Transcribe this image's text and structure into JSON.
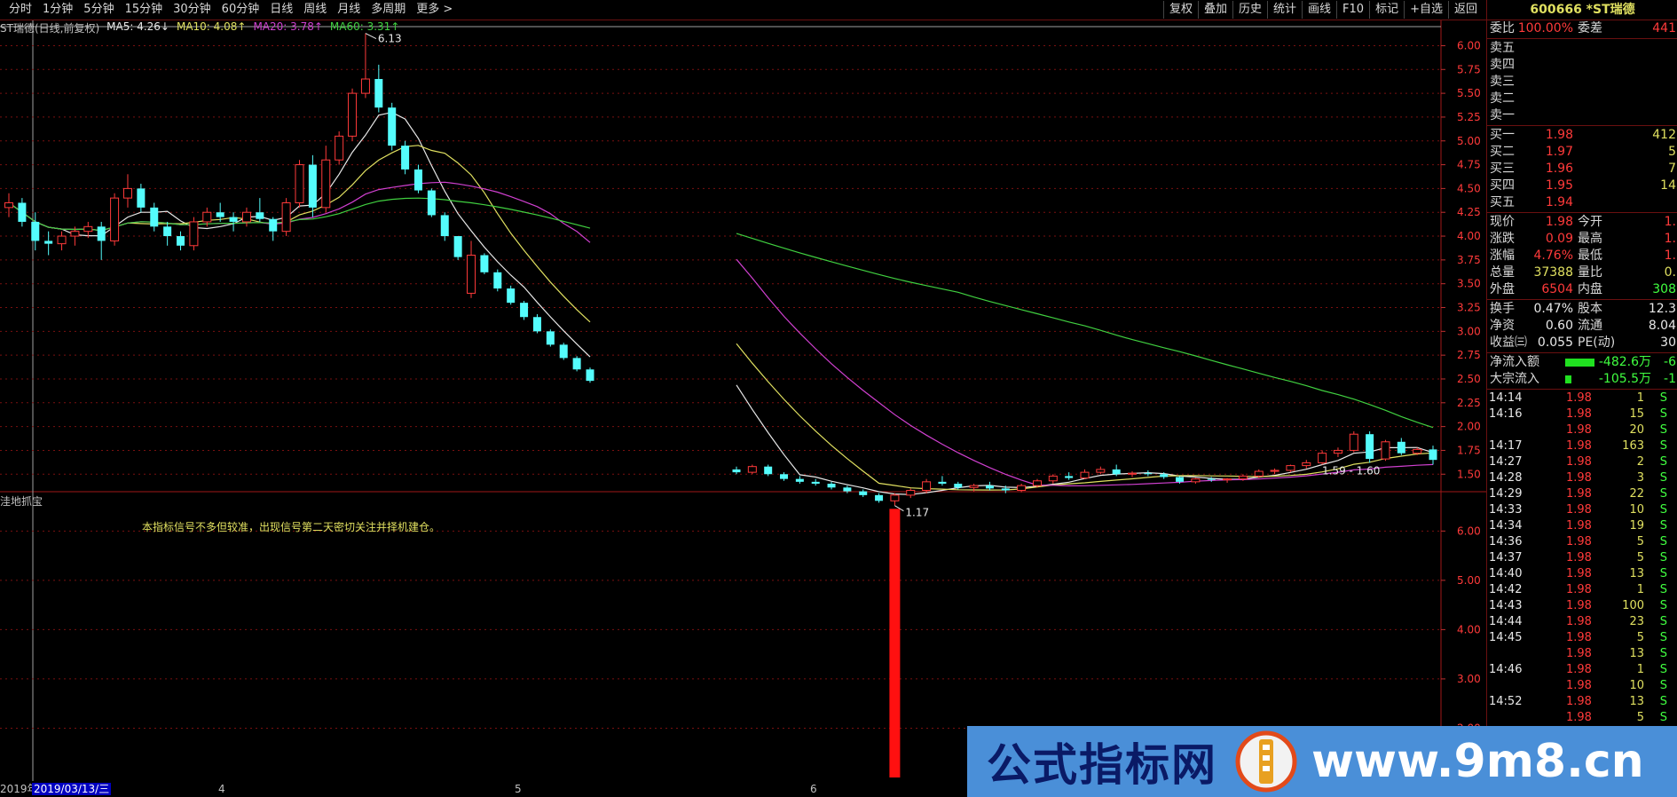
{
  "toolbar": {
    "periods": [
      "分时",
      "1分钟",
      "5分钟",
      "15分钟",
      "30分钟",
      "60分钟",
      "日线",
      "周线",
      "月线",
      "多周期",
      "更多 >"
    ],
    "actions": [
      "复权",
      "叠加",
      "历史",
      "统计",
      "画线",
      "F10",
      "标记",
      "+自选",
      "返回"
    ]
  },
  "legend": {
    "title": "ST瑞德(日线,前复权)",
    "ma5": "MA5: 4.26↓",
    "ma10": "MA10: 4.08↑",
    "ma20": "MA20: 3.78↑",
    "ma60": "MA60: 3.31↑"
  },
  "main_chart": {
    "price_ticks": [
      "6.00",
      "5.75",
      "5.50",
      "5.25",
      "5.00",
      "4.75",
      "4.50",
      "4.25",
      "4.00",
      "3.75",
      "3.50",
      "3.25",
      "3.00",
      "2.75",
      "2.50",
      "2.25",
      "2.00",
      "1.75",
      "1.50"
    ],
    "high_label": "6.13",
    "low_label": "1.17",
    "recent_label": "1.59 - 1.60"
  },
  "sub_chart": {
    "title": "洼地抓宝",
    "note": "本指标信号不多但较准，出现信号第二天密切关注并择机建仓。",
    "ticks": [
      "6.00",
      "5.00",
      "4.00",
      "3.00",
      "2.00"
    ]
  },
  "date_bar": {
    "current": "2019/03/13/三",
    "year": "2019年",
    "months": [
      "4",
      "5",
      "6"
    ]
  },
  "quote": {
    "code_name": "600666 *ST瑞德",
    "weibi_label": "委比",
    "weibi_value": "100.00%",
    "weicha_label": "委差",
    "weicha_value": "441",
    "asks": [
      {
        "label": "卖五",
        "price": "",
        "vol": ""
      },
      {
        "label": "卖四",
        "price": "",
        "vol": ""
      },
      {
        "label": "卖三",
        "price": "",
        "vol": ""
      },
      {
        "label": "卖二",
        "price": "",
        "vol": ""
      },
      {
        "label": "卖一",
        "price": "",
        "vol": ""
      }
    ],
    "bids": [
      {
        "label": "买一",
        "price": "1.98",
        "vol": "412"
      },
      {
        "label": "买二",
        "price": "1.97",
        "vol": "5"
      },
      {
        "label": "买三",
        "price": "1.96",
        "vol": "7"
      },
      {
        "label": "买四",
        "price": "1.95",
        "vol": "14"
      },
      {
        "label": "买五",
        "price": "1.94",
        "vol": ""
      }
    ],
    "stats": [
      {
        "l1": "现价",
        "v1": "1.98",
        "c1": "red",
        "l2": "今开",
        "v2": "1.",
        "c2": "red"
      },
      {
        "l1": "涨跌",
        "v1": "0.09",
        "c1": "red",
        "l2": "最高",
        "v2": "1.",
        "c2": "red"
      },
      {
        "l1": "涨幅",
        "v1": "4.76%",
        "c1": "red",
        "l2": "最低",
        "v2": "1.",
        "c2": "red"
      },
      {
        "l1": "总量",
        "v1": "37388",
        "c1": "yellow",
        "l2": "量比",
        "v2": "0.",
        "c2": "yellow"
      },
      {
        "l1": "外盘",
        "v1": "6504",
        "c1": "red",
        "l2": "内盘",
        "v2": "308",
        "c2": "green"
      }
    ],
    "stats2": [
      {
        "l1": "换手",
        "v1": "0.47%",
        "c1": "white",
        "l2": "股本",
        "v2": "12.3",
        "c2": "white"
      },
      {
        "l1": "净资",
        "v1": "0.60",
        "c1": "white",
        "l2": "流通",
        "v2": "8.04",
        "c2": "white"
      },
      {
        "l1": "收益㈢",
        "v1": "0.055",
        "c1": "white",
        "l2": "PE(动)",
        "v2": "30",
        "c2": "white"
      }
    ],
    "flows": [
      {
        "label": "净流入额",
        "value": "-482.6万",
        "extra": "-6",
        "bar": 0.55
      },
      {
        "label": "大宗流入",
        "value": "-105.5万",
        "extra": "-1",
        "bar": 0.12
      }
    ],
    "ticks": [
      {
        "time": "14:14",
        "price": "1.98",
        "vol": "1",
        "side": "S"
      },
      {
        "time": "14:16",
        "price": "1.98",
        "vol": "15",
        "side": "S"
      },
      {
        "time": "",
        "price": "1.98",
        "vol": "20",
        "side": "S"
      },
      {
        "time": "14:17",
        "price": "1.98",
        "vol": "163",
        "side": "S"
      },
      {
        "time": "14:27",
        "price": "1.98",
        "vol": "2",
        "side": "S"
      },
      {
        "time": "14:28",
        "price": "1.98",
        "vol": "3",
        "side": "S"
      },
      {
        "time": "14:29",
        "price": "1.98",
        "vol": "22",
        "side": "S"
      },
      {
        "time": "14:33",
        "price": "1.98",
        "vol": "10",
        "side": "S"
      },
      {
        "time": "14:34",
        "price": "1.98",
        "vol": "19",
        "side": "S"
      },
      {
        "time": "14:36",
        "price": "1.98",
        "vol": "5",
        "side": "S"
      },
      {
        "time": "14:37",
        "price": "1.98",
        "vol": "5",
        "side": "S"
      },
      {
        "time": "14:40",
        "price": "1.98",
        "vol": "13",
        "side": "S"
      },
      {
        "time": "14:42",
        "price": "1.98",
        "vol": "1",
        "side": "S"
      },
      {
        "time": "14:43",
        "price": "1.98",
        "vol": "100",
        "side": "S"
      },
      {
        "time": "14:44",
        "price": "1.98",
        "vol": "23",
        "side": "S"
      },
      {
        "time": "14:45",
        "price": "1.98",
        "vol": "5",
        "side": "S"
      },
      {
        "time": "",
        "price": "1.98",
        "vol": "13",
        "side": "S"
      },
      {
        "time": "14:46",
        "price": "1.98",
        "vol": "1",
        "side": "S"
      },
      {
        "time": "",
        "price": "1.98",
        "vol": "10",
        "side": "S"
      },
      {
        "time": "14:52",
        "price": "1.98",
        "vol": "13",
        "side": "S"
      },
      {
        "time": "",
        "price": "1.98",
        "vol": "5",
        "side": "S"
      }
    ]
  },
  "watermark": {
    "left_text": "公式指标网",
    "right_text": "www.9m8.cn"
  },
  "colors": {
    "up": "#ff3a3a",
    "down": "#54fcfc",
    "ma5": "#e8e8e8",
    "ma10": "#e0e060",
    "ma20": "#d040d0",
    "ma60": "#40d040",
    "grid": "#7a1010"
  },
  "chart_data": {
    "type": "candlestick",
    "price_range": [
      1.4,
      6.2
    ],
    "indicator_range": [
      1.0,
      6.6
    ],
    "candles": [
      [
        4.3,
        4.45,
        4.2,
        4.35
      ],
      [
        4.35,
        4.4,
        4.1,
        4.15
      ],
      [
        4.15,
        4.25,
        3.85,
        3.95
      ],
      [
        3.95,
        4.05,
        3.8,
        3.92
      ],
      [
        3.92,
        4.05,
        3.85,
        4.0
      ],
      [
        4.0,
        4.1,
        3.9,
        4.05
      ],
      [
        4.05,
        4.15,
        3.98,
        4.1
      ],
      [
        4.1,
        4.15,
        3.75,
        3.95
      ],
      [
        3.95,
        4.45,
        3.9,
        4.4
      ],
      [
        4.4,
        4.65,
        4.3,
        4.5
      ],
      [
        4.5,
        4.55,
        4.25,
        4.3
      ],
      [
        4.3,
        4.35,
        4.05,
        4.1
      ],
      [
        4.1,
        4.15,
        3.9,
        4.0
      ],
      [
        4.0,
        4.05,
        3.85,
        3.9
      ],
      [
        3.9,
        4.2,
        3.85,
        4.15
      ],
      [
        4.15,
        4.3,
        4.1,
        4.25
      ],
      [
        4.25,
        4.35,
        4.15,
        4.2
      ],
      [
        4.2,
        4.25,
        4.05,
        4.15
      ],
      [
        4.15,
        4.3,
        4.1,
        4.25
      ],
      [
        4.25,
        4.4,
        4.15,
        4.18
      ],
      [
        4.18,
        4.2,
        3.95,
        4.05
      ],
      [
        4.05,
        4.4,
        4.0,
        4.35
      ],
      [
        4.35,
        4.8,
        4.3,
        4.75
      ],
      [
        4.75,
        4.85,
        4.2,
        4.3
      ],
      [
        4.3,
        4.95,
        4.25,
        4.8
      ],
      [
        4.8,
        5.1,
        4.75,
        5.05
      ],
      [
        5.05,
        5.55,
        5.0,
        5.5
      ],
      [
        5.5,
        6.13,
        5.45,
        5.65
      ],
      [
        5.65,
        5.8,
        5.3,
        5.35
      ],
      [
        5.35,
        5.4,
        4.9,
        4.95
      ],
      [
        4.95,
        5.0,
        4.65,
        4.7
      ],
      [
        4.7,
        4.75,
        4.45,
        4.48
      ],
      [
        4.48,
        4.5,
        4.2,
        4.22
      ],
      [
        4.22,
        4.25,
        3.95,
        4.0
      ],
      [
        4.0,
        4.0,
        3.75,
        3.78
      ],
      [
        3.4,
        3.95,
        3.35,
        3.8
      ],
      [
        3.8,
        3.82,
        3.6,
        3.62
      ],
      [
        3.62,
        3.65,
        3.42,
        3.45
      ],
      [
        3.45,
        3.48,
        3.28,
        3.3
      ],
      [
        3.3,
        3.32,
        3.12,
        3.15
      ],
      [
        3.15,
        3.18,
        2.98,
        3.0
      ],
      [
        3.0,
        3.02,
        2.84,
        2.86
      ],
      [
        2.86,
        2.88,
        2.7,
        2.72
      ],
      [
        2.72,
        2.74,
        2.58,
        2.6
      ],
      [
        2.6,
        2.62,
        2.46,
        2.48
      ],
      [
        1.55,
        1.58,
        1.5,
        1.52
      ],
      [
        1.52,
        1.6,
        1.5,
        1.58
      ],
      [
        1.58,
        1.6,
        1.48,
        1.5
      ],
      [
        1.5,
        1.52,
        1.43,
        1.45
      ],
      [
        1.45,
        1.48,
        1.4,
        1.42
      ],
      [
        1.42,
        1.45,
        1.38,
        1.4
      ],
      [
        1.4,
        1.42,
        1.34,
        1.36
      ],
      [
        1.36,
        1.38,
        1.3,
        1.32
      ],
      [
        1.32,
        1.34,
        1.26,
        1.28
      ],
      [
        1.28,
        1.3,
        1.2,
        1.22
      ],
      [
        1.22,
        1.3,
        1.17,
        1.28
      ],
      [
        1.28,
        1.35,
        1.25,
        1.33
      ],
      [
        1.33,
        1.45,
        1.3,
        1.42
      ],
      [
        1.42,
        1.48,
        1.38,
        1.4
      ],
      [
        1.4,
        1.42,
        1.34,
        1.36
      ],
      [
        1.36,
        1.4,
        1.32,
        1.38
      ],
      [
        1.38,
        1.42,
        1.33,
        1.35
      ],
      [
        1.35,
        1.38,
        1.3,
        1.33
      ],
      [
        1.33,
        1.4,
        1.31,
        1.38
      ],
      [
        1.38,
        1.45,
        1.36,
        1.43
      ],
      [
        1.43,
        1.5,
        1.4,
        1.48
      ],
      [
        1.48,
        1.52,
        1.44,
        1.46
      ],
      [
        1.46,
        1.55,
        1.45,
        1.52
      ],
      [
        1.52,
        1.58,
        1.5,
        1.55
      ],
      [
        1.55,
        1.6,
        1.48,
        1.5
      ],
      [
        1.5,
        1.53,
        1.47,
        1.51
      ],
      [
        1.51,
        1.54,
        1.48,
        1.5
      ],
      [
        1.5,
        1.52,
        1.45,
        1.47
      ],
      [
        1.47,
        1.48,
        1.4,
        1.42
      ],
      [
        1.42,
        1.46,
        1.4,
        1.45
      ],
      [
        1.45,
        1.47,
        1.42,
        1.44
      ],
      [
        1.44,
        1.46,
        1.41,
        1.45
      ],
      [
        1.45,
        1.5,
        1.43,
        1.48
      ],
      [
        1.48,
        1.55,
        1.46,
        1.53
      ],
      [
        1.53,
        1.56,
        1.5,
        1.54
      ],
      [
        1.54,
        1.6,
        1.52,
        1.59
      ],
      [
        1.59,
        1.65,
        1.56,
        1.62
      ],
      [
        1.62,
        1.75,
        1.6,
        1.72
      ],
      [
        1.72,
        1.78,
        1.68,
        1.75
      ],
      [
        1.75,
        1.95,
        1.73,
        1.92
      ],
      [
        1.92,
        1.95,
        1.62,
        1.66
      ],
      [
        1.66,
        1.86,
        1.64,
        1.84
      ],
      [
        1.84,
        1.88,
        1.7,
        1.72
      ],
      [
        1.72,
        1.78,
        1.7,
        1.76
      ],
      [
        1.76,
        1.8,
        1.6,
        1.65
      ]
    ],
    "visible_segments": [
      [
        0,
        44
      ],
      [
        45,
        89
      ]
    ],
    "signal": {
      "index": 55,
      "value": 6.45
    }
  }
}
